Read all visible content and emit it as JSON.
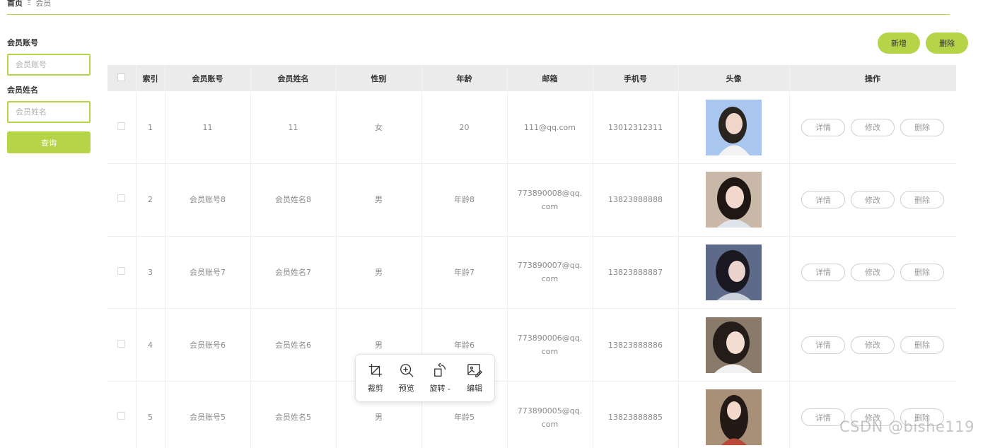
{
  "breadcrumb": {
    "home": "首页",
    "separator": "Ξ",
    "current": "会员"
  },
  "search": {
    "account_label": "会员账号",
    "account_placeholder": "会员账号",
    "name_label": "会员姓名",
    "name_placeholder": "会员姓名",
    "query_button": "查询"
  },
  "actions": {
    "add": "新增",
    "delete": "删除"
  },
  "table": {
    "columns": [
      "索引",
      "会员账号",
      "会员姓名",
      "性别",
      "年龄",
      "邮箱",
      "手机号",
      "头像",
      "操作"
    ],
    "rows": [
      {
        "index": "1",
        "account": "11",
        "name": "11",
        "gender": "女",
        "age": "20",
        "email": "111@qq.com",
        "phone": "13012312311"
      },
      {
        "index": "2",
        "account": "会员账号8",
        "name": "会员姓名8",
        "gender": "男",
        "age": "年龄8",
        "email": "773890008@qq.com",
        "phone": "13823888888"
      },
      {
        "index": "3",
        "account": "会员账号7",
        "name": "会员姓名7",
        "gender": "男",
        "age": "年龄7",
        "email": "773890007@qq.com",
        "phone": "13823888887"
      },
      {
        "index": "4",
        "account": "会员账号6",
        "name": "会员姓名6",
        "gender": "男",
        "age": "年龄6",
        "email": "773890006@qq.com",
        "phone": "13823888886"
      },
      {
        "index": "5",
        "account": "会员账号5",
        "name": "会员姓名5",
        "gender": "男",
        "age": "年龄5",
        "email": "773890005@qq.com",
        "phone": "13823888885"
      }
    ],
    "row_actions": {
      "detail": "详情",
      "edit": "修改",
      "delete": "删除"
    }
  },
  "image_toolbar": {
    "crop": "裁剪",
    "preview": "预览",
    "rotate": "旋转",
    "edit": "编辑"
  },
  "watermark": "CSDN @bishe119",
  "colors": {
    "accent": "#b5d447",
    "header_bg": "#ebebeb"
  }
}
